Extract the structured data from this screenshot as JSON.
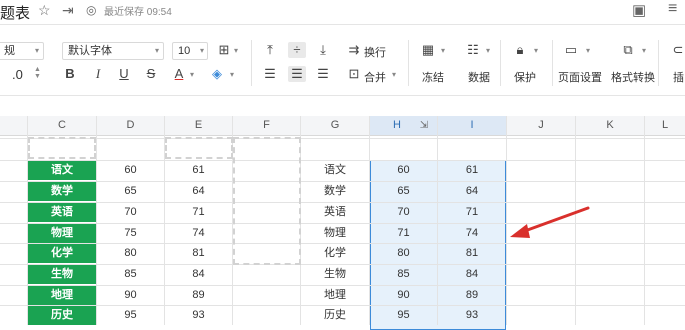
{
  "header": {
    "title": "题表",
    "saved_text": "最近保存 09:54"
  },
  "toolbar": {
    "style_select": "规",
    "decimal": ".0",
    "font_name": "默认字体",
    "font_size": "10",
    "bold": "B",
    "italic": "I",
    "underline": "U",
    "strike": "S",
    "font_color": "A",
    "wrap_label": "换行",
    "merge_label": "合并",
    "freeze_label": "冻结",
    "data_label": "数据",
    "protect_label": "保护",
    "page_setup_label": "页面设置",
    "format_convert_label": "格式转换",
    "insert_label": "插"
  },
  "grid": {
    "columns": [
      "C",
      "D",
      "E",
      "F",
      "G",
      "H",
      "I",
      "J",
      "K",
      "L"
    ],
    "rows": [
      {
        "subject_a": "语文",
        "d": "60",
        "e": "61",
        "subject_b": "语文",
        "h": "60",
        "i": "61"
      },
      {
        "subject_a": "数学",
        "d": "65",
        "e": "64",
        "subject_b": "数学",
        "h": "65",
        "i": "64"
      },
      {
        "subject_a": "英语",
        "d": "70",
        "e": "71",
        "subject_b": "英语",
        "h": "70",
        "i": "71"
      },
      {
        "subject_a": "物理",
        "d": "75",
        "e": "74",
        "subject_b": "物理",
        "h": "71",
        "i": "74"
      },
      {
        "subject_a": "化学",
        "d": "80",
        "e": "81",
        "subject_b": "化学",
        "h": "80",
        "i": "81"
      },
      {
        "subject_a": "生物",
        "d": "85",
        "e": "84",
        "subject_b": "生物",
        "h": "85",
        "i": "84"
      },
      {
        "subject_a": "地理",
        "d": "90",
        "e": "89",
        "subject_b": "地理",
        "h": "90",
        "i": "89"
      },
      {
        "subject_a": "历史",
        "d": "95",
        "e": "93",
        "subject_b": "历史",
        "h": "95",
        "i": "93"
      }
    ]
  },
  "colors": {
    "subject_fill": "#1aa352",
    "selection_fill": "#e6f1fb",
    "selection_border": "#3d8bd9",
    "arrow": "#d9302c"
  }
}
